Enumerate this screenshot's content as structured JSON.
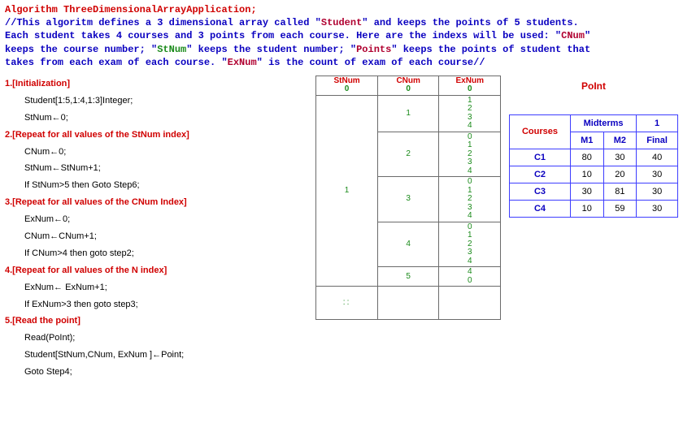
{
  "header": {
    "algo_title": "Algorithm ThreeDimensionalArrayApplication;",
    "comment_line1_a": "//This algoritm defines a 3 dimensional array called \"",
    "kw_student": "Student",
    "comment_line1_b": "\" and keeps the points of 5 students.",
    "comment_line2_a": "Each student takes 4 courses and 3 points from each course. Here are the indexs will be used: \"",
    "kw_cnum": "CNum",
    "comment_line2_b": "\"",
    "comment_line3_a": "keeps the course number; \"",
    "kw_stnum": "StNum",
    "comment_line3_b": "\" keeps the student number; \"",
    "kw_points": "Points",
    "comment_line3_c": "\" keeps the points of student that",
    "comment_line4_a": "takes from each exam of each course. \"",
    "kw_exnum": "ExNum",
    "comment_line4_b": "\" is the count of exam of each course//"
  },
  "steps": {
    "s1": {
      "label": "1.[Initialization]",
      "l1": "Student[1:5,1:4,1:3]Integer;",
      "l2": "StNum←0;"
    },
    "s2": {
      "label": "2.[Repeat for all values of the StNum index]",
      "l1": "CNum←0;",
      "l2": "StNum←StNum+1;",
      "l3": "If StNum>5 then Goto Step6;"
    },
    "s3": {
      "label": "3.[Repeat for all values of the CNum Index]",
      "l1": "ExNum←0;",
      "l2": "CNum←CNum+1;",
      "l3": "If CNum>4 then goto step2;"
    },
    "s4": {
      "label": "4.[Repeat for all values of the N index]",
      "l1": "ExNum← ExNum+1;",
      "l2": "If ExNum>3 then goto step3;"
    },
    "s5": {
      "label": "5.[Read the point]",
      "l1": "Read(PoInt);",
      "l2": "Student[StNum,CNum, ExNum ]←Point;",
      "l3": "Goto Step4;"
    }
  },
  "trace": {
    "h_st": "StNum",
    "h_cn": "CNum",
    "h_ex": "ExNum",
    "zero": "0",
    "st1": "1",
    "cn1": "1",
    "cn2": "2",
    "cn3": "3",
    "cn4": "4",
    "cn5": "5",
    "exseq": {
      "a": "0",
      "b": "1",
      "c": "2",
      "d": "3",
      "e": "4"
    },
    "tail": {
      "a": "4",
      "b": "0"
    },
    "dots": "::"
  },
  "point": {
    "title": "PoInt",
    "head_courses": "Courses",
    "head_midterms": "Midterms",
    "head_one": "1",
    "m1": "M1",
    "m2": "M2",
    "final": "Final",
    "rows": [
      {
        "c": "C1",
        "m1": "80",
        "m2": "30",
        "f": "40"
      },
      {
        "c": "C2",
        "m1": "10",
        "m2": "20",
        "f": "30"
      },
      {
        "c": "C3",
        "m1": "30",
        "m2": "81",
        "f": "30"
      },
      {
        "c": "C4",
        "m1": "10",
        "m2": "59",
        "f": "30"
      }
    ]
  }
}
